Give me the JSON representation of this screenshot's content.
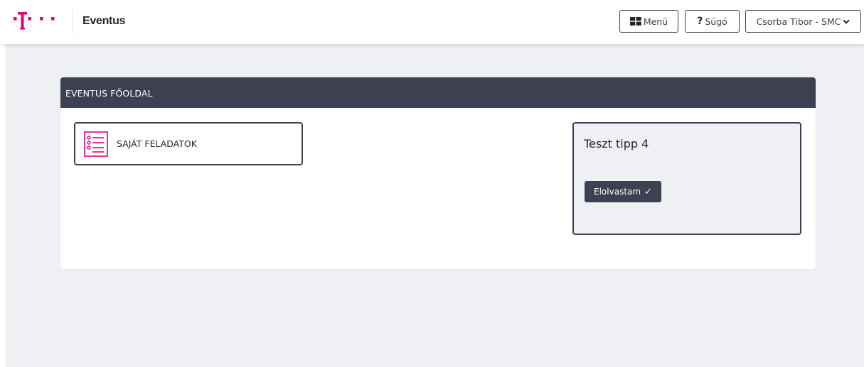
{
  "header": {
    "logo_icon": "telekom-logo",
    "app_name": "Eventus",
    "menu_button": {
      "icon": "grid-icon",
      "label": "Menü"
    },
    "help_button": {
      "icon": "question-icon",
      "label": "Súgó"
    },
    "user_button": {
      "label": "Csorba Tibor - SMC",
      "icon": "chevron-down-icon"
    }
  },
  "main": {
    "card_title": "EVENTUS FŐOLDAL",
    "task_tile": {
      "icon": "task-list-icon",
      "label": "SAJÁT FELADATOK"
    },
    "tip": {
      "title": "Teszt tipp 4",
      "button_label": "Elolvastam",
      "button_icon": "check-icon"
    }
  },
  "colors": {
    "brand_magenta": "#e20074",
    "dark_slate": "#3d4050",
    "page_background": "#eef0f4"
  }
}
